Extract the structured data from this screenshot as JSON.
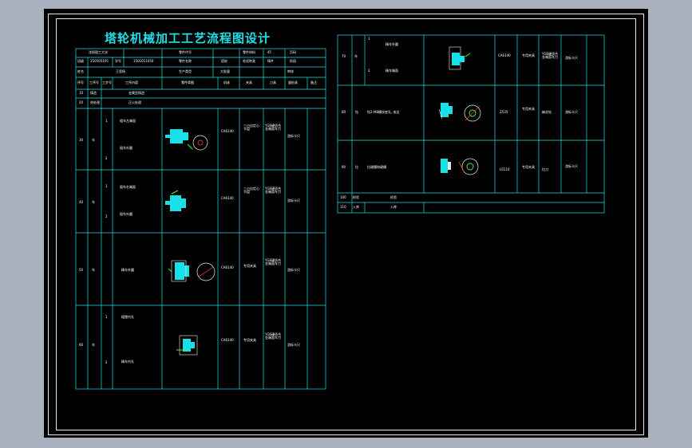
{
  "drawing": {
    "title": "塔轮机械加工工艺流程图设计",
    "header": {
      "school": "沈阳理工大学",
      "part_code_label": "零件代号",
      "material_label": "零件材料",
      "material_value": "45",
      "sheet_label": "页码",
      "class_label": "班级",
      "class_value": "150505105",
      "id_label": "学号",
      "id_value": "1501011050",
      "part_name_label": "零件名称",
      "part_name_value": "塔轮",
      "blank_type_label": "毛坯种类",
      "blank_type_value": "铸件",
      "stage_label": "阶段",
      "name_label": "姓名",
      "name_value": "王思扬",
      "production_label": "生产类型",
      "production_value": "大批量",
      "review_label": "审核"
    },
    "columns": {
      "seq": "序号",
      "process_no": "工序号",
      "step_no": "工步号",
      "content": "工序内容",
      "sketch": "零件简图",
      "machine": "机床",
      "fixture": "夹具",
      "tool": "刀具",
      "measure": "量检具",
      "remark": "备注"
    },
    "rows_left": [
      {
        "seq": "10",
        "proc": "铸造",
        "content": "金属型铸造"
      },
      {
        "seq": "20",
        "proc": "热处理",
        "content": "正火处理"
      },
      {
        "seq": "30",
        "proc": "车",
        "steps": [
          "1",
          "2"
        ],
        "contents": [
          "粗车左端面",
          "粗车外圆"
        ],
        "machine": "CA6140",
        "fixture": "三爪自定心卡盘",
        "tool": "YG6硬质合金端面车刀",
        "measure": "游标卡尺"
      },
      {
        "seq": "40",
        "proc": "车",
        "steps": [
          "1",
          "2"
        ],
        "contents": [
          "粗车右端面",
          "粗车外圆"
        ],
        "machine": "CA6140",
        "fixture": "三爪自定心卡盘",
        "tool": "YG6硬质合金端面车刀",
        "measure": "游标卡尺"
      },
      {
        "seq": "50",
        "proc": "车",
        "contents": [
          "精车外圆"
        ],
        "machine": "CA6140",
        "fixture": "专用夹具",
        "tool": "YG6硬质合金端面车刀",
        "measure": "游标卡尺"
      },
      {
        "seq": "60",
        "proc": "车",
        "steps": [
          "1",
          "2"
        ],
        "contents": [
          "粗镗内孔",
          "精车内孔"
        ],
        "machine": "CA6140",
        "fixture": "专用夹具",
        "tool": "YG6硬质合金端面车刀",
        "measure": "游标卡尺"
      }
    ],
    "rows_right": [
      {
        "seq": "70",
        "proc": "车",
        "steps": [
          "1",
          "2"
        ],
        "contents": [
          "精车外圆",
          "精车端面"
        ],
        "machine": "CA6140",
        "fixture": "专用夹具",
        "tool": "YG6硬质合金端面车刀",
        "measure": "游标卡尺"
      },
      {
        "seq": "80",
        "proc": "钻",
        "contents": [
          "钻2-M8螺纹底孔, 攻丝"
        ],
        "machine": "Z535",
        "fixture": "专用夹具",
        "tool": "麻花钻",
        "measure": "游标卡尺"
      },
      {
        "seq": "90",
        "proc": "拉",
        "contents": [
          "拉键槽和键槽"
        ],
        "machine": "L6110",
        "fixture": "专用夹具",
        "tool": "拉刀",
        "measure": "游标卡尺"
      },
      {
        "seq": "100",
        "proc": "检验",
        "content": "检验"
      },
      {
        "seq": "110",
        "proc": "入库",
        "content": "入库"
      }
    ]
  }
}
